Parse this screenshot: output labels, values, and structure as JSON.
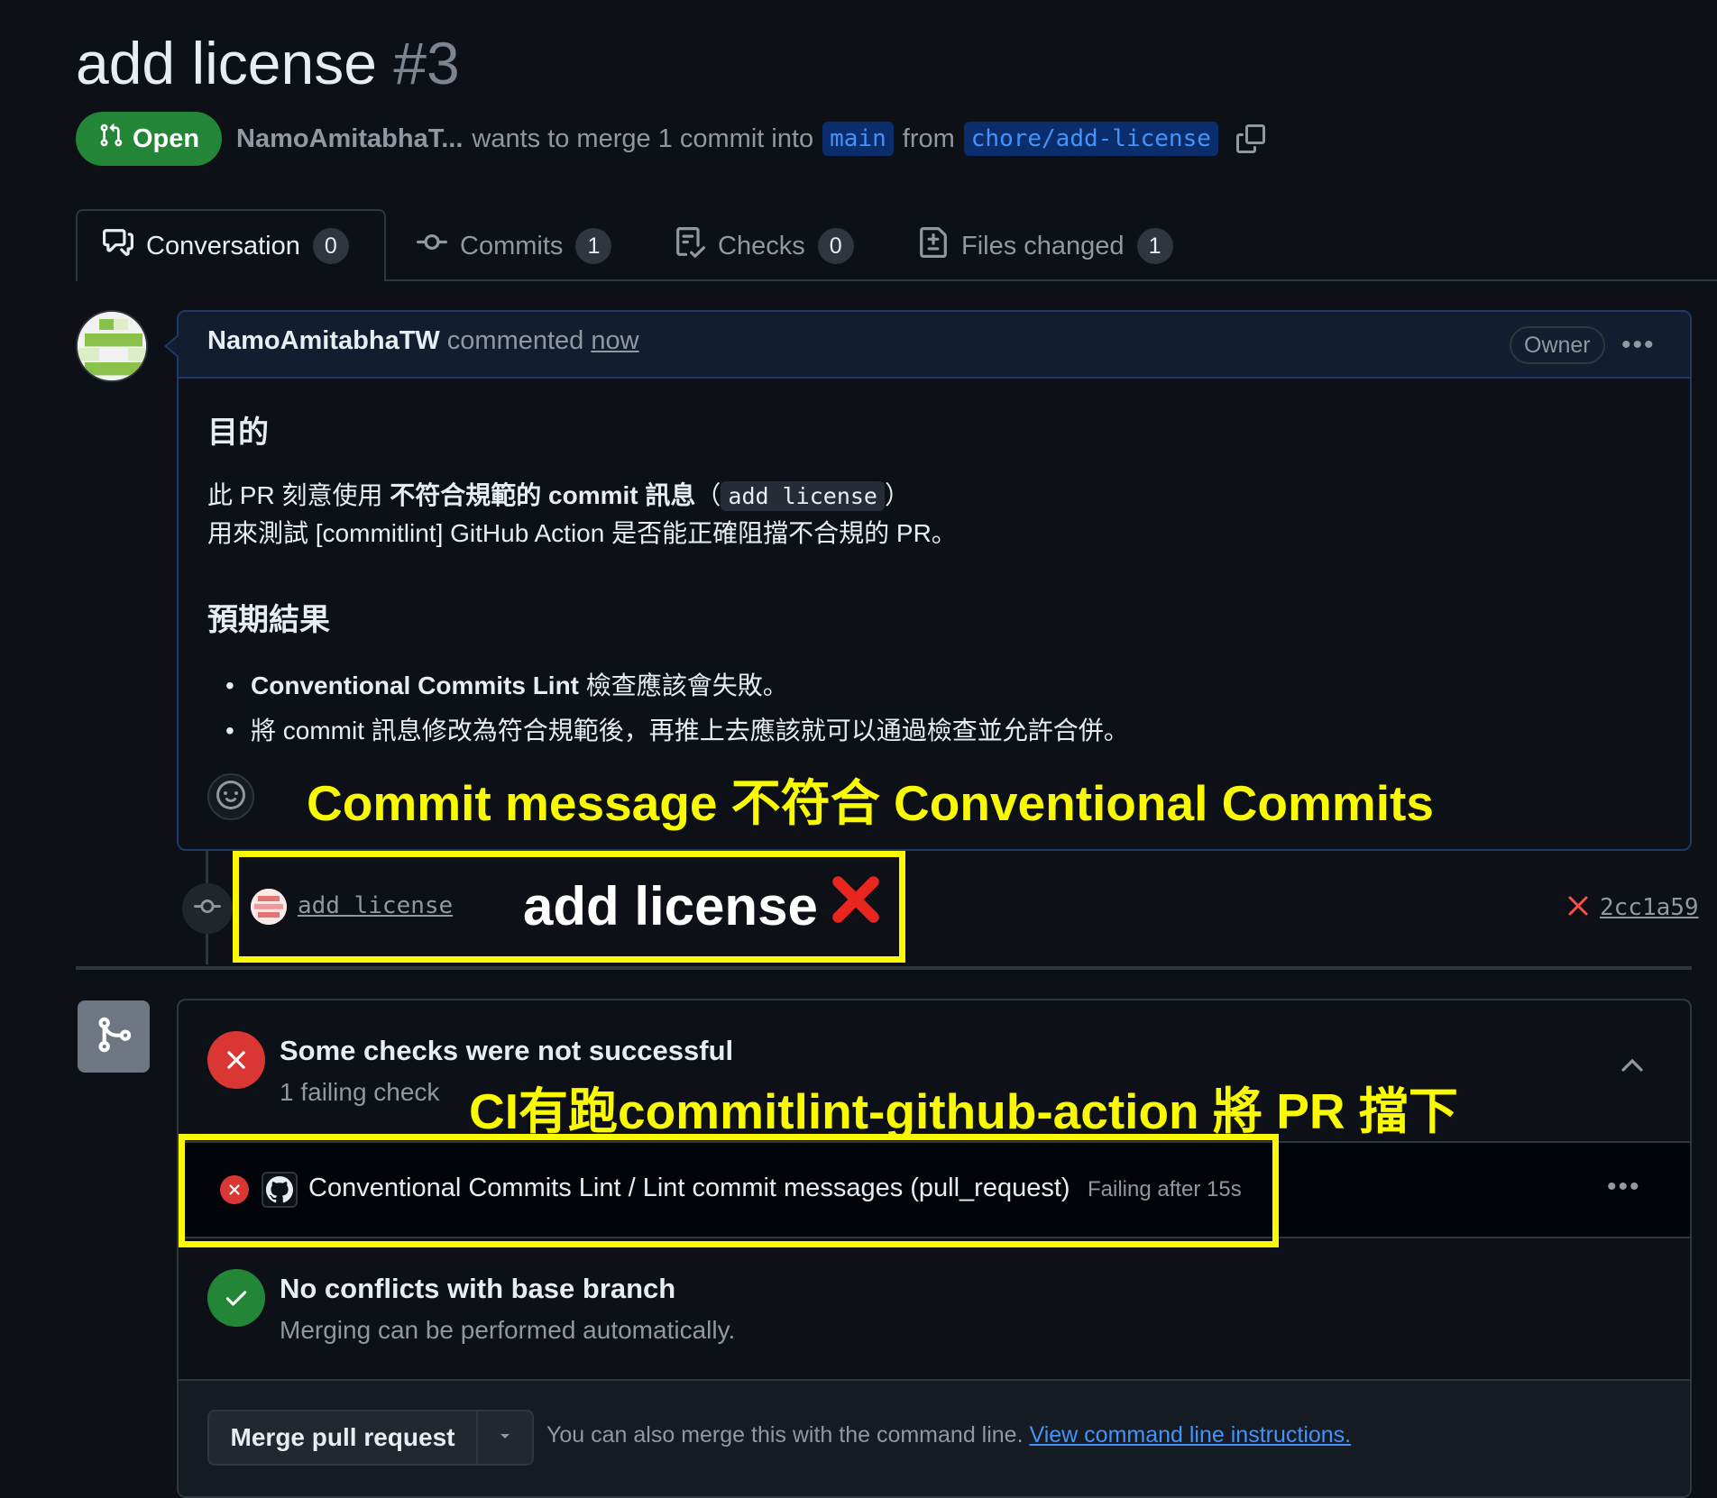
{
  "pr": {
    "title": "add license",
    "number": "#3",
    "state": "Open",
    "author": "NamoAmitabhaT...",
    "merge_text": "wants to merge 1 commit into",
    "base_branch": "main",
    "from_text": "from",
    "head_branch": "chore/add-license"
  },
  "tabs": [
    {
      "label": "Conversation",
      "count": "0",
      "active": true
    },
    {
      "label": "Commits",
      "count": "1",
      "active": false
    },
    {
      "label": "Checks",
      "count": "0",
      "active": false
    },
    {
      "label": "Files changed",
      "count": "1",
      "active": false
    }
  ],
  "comment": {
    "author": "NamoAmitabhaTW",
    "verb": "commented",
    "time": "now",
    "role_badge": "Owner",
    "heading_purpose": "目的",
    "line1_prefix": "此 PR 刻意使用 ",
    "line1_bold": "不符合規範的 commit 訊息",
    "line1_open": "（",
    "line1_code": "add license",
    "line1_close": "）",
    "line2": "用來測試 [commitlint] GitHub Action 是否能正確阻擋不合規的 PR。",
    "heading_expect": "預期結果",
    "bullet1_bold": "Conventional Commits Lint",
    "bullet1_rest": " 檢查應該會失敗。",
    "bullet2": "將 commit 訊息修改為符合規範後，再推上去應該就可以通過檢查並允許合併。"
  },
  "annotations": {
    "a1": "Commit message 不符合 Conventional Commits",
    "a2": "add license",
    "a3": "CI有跑commitlint-github-action 將 PR 擋下",
    "highlight_color": "#f9f900"
  },
  "commit": {
    "message": "add license",
    "sha": "2cc1a59"
  },
  "merge": {
    "checks_title": "Some checks were not successful",
    "checks_sub": "1 failing check",
    "check_name": "Conventional Commits Lint / Lint commit messages (pull_request)",
    "check_duration": "Failing after 15s",
    "conflict_title": "No conflicts with base branch",
    "conflict_sub": "Merging can be performed automatically.",
    "merge_button": "Merge pull request",
    "hint_text": "You can also merge this with the command line.",
    "hint_link": "View command line instructions."
  },
  "colors": {
    "open_green": "#238636",
    "fail_red": "#da3633",
    "link_blue": "#4493f8"
  }
}
